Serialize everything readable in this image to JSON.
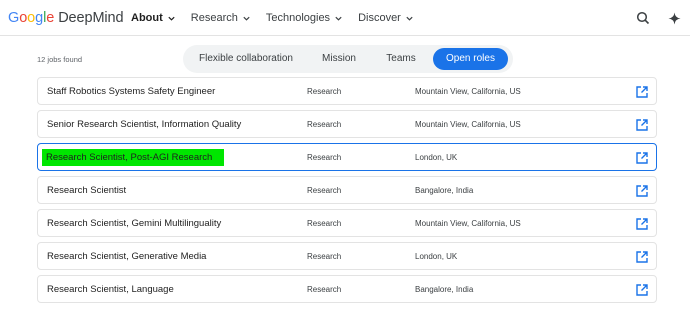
{
  "header": {
    "logo_google": "Google",
    "logo_deepmind": "DeepMind",
    "nav": [
      {
        "label": "About",
        "active": true
      },
      {
        "label": "Research",
        "active": false
      },
      {
        "label": "Technologies",
        "active": false
      },
      {
        "label": "Discover",
        "active": false
      }
    ],
    "icons": [
      "search-icon",
      "sparkle-icon"
    ]
  },
  "jobs_count": "12 jobs found",
  "tabs": [
    {
      "label": "Flexible collaboration",
      "active": false
    },
    {
      "label": "Mission",
      "active": false
    },
    {
      "label": "Teams",
      "active": false
    },
    {
      "label": "Open roles",
      "active": true
    }
  ],
  "jobs": [
    {
      "title": "Staff Robotics Systems Safety Engineer",
      "team": "Research",
      "location": "Mountain View, California, US",
      "selected": false
    },
    {
      "title": "Senior Research Scientist, Information Quality",
      "team": "Research",
      "location": "Mountain View, California, US",
      "selected": false
    },
    {
      "title": "Research Scientist, Post-AGI Research",
      "team": "Research",
      "location": "London, UK",
      "selected": true
    },
    {
      "title": "Research Scientist",
      "team": "Research",
      "location": "Bangalore, India",
      "selected": false
    },
    {
      "title": "Research Scientist, Gemini Multilinguality",
      "team": "Research",
      "location": "Mountain View, California, US",
      "selected": false
    },
    {
      "title": "Research Scientist, Generative Media",
      "team": "Research",
      "location": "London, UK",
      "selected": false
    },
    {
      "title": "Research Scientist, Language",
      "team": "Research",
      "location": "Bangalore, India",
      "selected": false
    }
  ],
  "colors": {
    "accent": "#1a73e8",
    "highlight": "#00e600",
    "border": "#e3e3e3"
  }
}
